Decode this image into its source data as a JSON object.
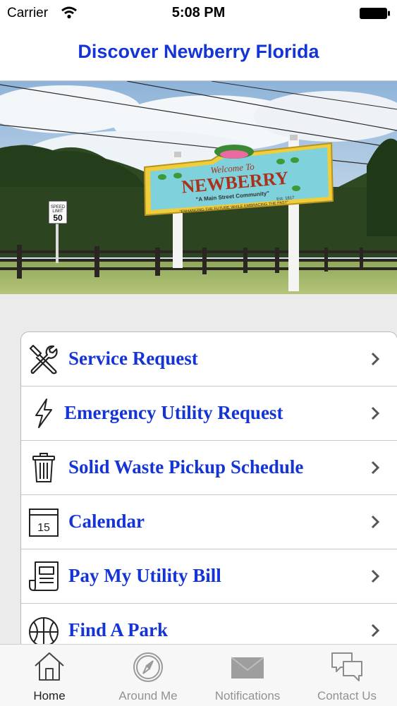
{
  "status_bar": {
    "carrier": "Carrier",
    "time": "5:08 PM",
    "wifi_icon": "wifi-icon",
    "battery_icon": "battery-icon"
  },
  "nav": {
    "title": "Discover Newberry Florida"
  },
  "hero": {
    "description": "Welcome To Newberry town sign with fence and trees",
    "sign": {
      "welcome": "Welcome To",
      "name": "NEWBERRY",
      "tagline": "\"A Main Street Community\"",
      "est": "Est. 1817",
      "motto": "\"ENHANCING THE FUTURE WHILE EMBRACING THE PAST\""
    },
    "speed_sign": {
      "line1": "SPEED",
      "line2": "LIMIT",
      "value": "50"
    }
  },
  "menu": {
    "items": [
      {
        "label": "Service Request",
        "icon": "tools-icon"
      },
      {
        "label": "Emergency Utility Request",
        "icon": "lightning-icon"
      },
      {
        "label": "Solid Waste Pickup Schedule",
        "icon": "trash-icon"
      },
      {
        "label": "Calendar",
        "icon": "calendar-icon",
        "icon_text": "15"
      },
      {
        "label": "Pay My Utility Bill",
        "icon": "bill-icon"
      },
      {
        "label": "Find A Park",
        "icon": "basketball-icon"
      }
    ]
  },
  "tab_bar": {
    "tabs": [
      {
        "label": "Home",
        "icon": "home-icon",
        "active": true
      },
      {
        "label": "Around Me",
        "icon": "compass-icon",
        "active": false
      },
      {
        "label": "Notifications",
        "icon": "envelope-icon",
        "active": false
      },
      {
        "label": "Contact Us",
        "icon": "chat-bubbles-icon",
        "active": false
      }
    ]
  },
  "colors": {
    "accent": "#1434d6",
    "chevron": "#555555",
    "tab_inactive": "#929292",
    "tab_active": "#222222"
  }
}
